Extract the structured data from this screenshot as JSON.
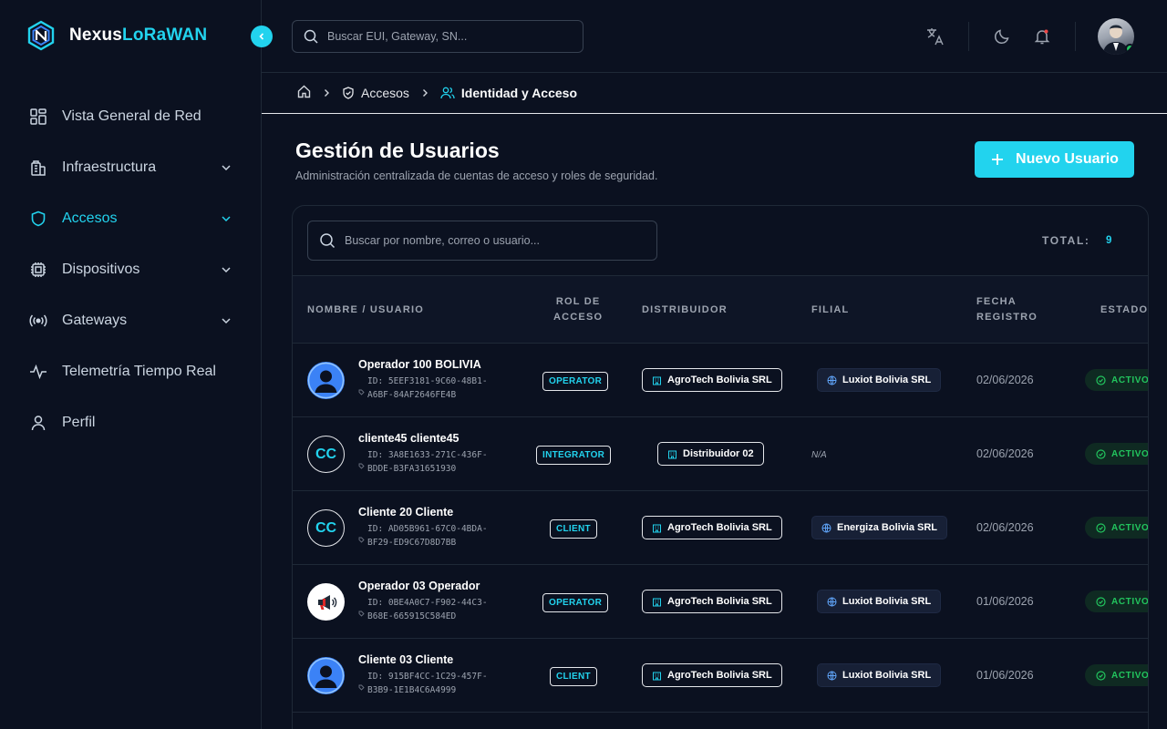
{
  "brand": {
    "name_part1": "Nexus",
    "name_part2": "LoRaWAN"
  },
  "sidebar": {
    "items": [
      {
        "label": "Vista General de Red",
        "icon": "grid-icon",
        "active": false,
        "has_chevron": false
      },
      {
        "label": "Infraestructura",
        "icon": "building-icon",
        "active": false,
        "has_chevron": true
      },
      {
        "label": "Accesos",
        "icon": "shield-icon",
        "active": true,
        "has_chevron": true
      },
      {
        "label": "Dispositivos",
        "icon": "chip-icon",
        "active": false,
        "has_chevron": true
      },
      {
        "label": "Gateways",
        "icon": "radio-icon",
        "active": false,
        "has_chevron": true
      },
      {
        "label": "Telemetría Tiempo Real",
        "icon": "activity-icon",
        "active": false,
        "has_chevron": false
      },
      {
        "label": "Perfil",
        "icon": "user-icon",
        "active": false,
        "has_chevron": false
      }
    ]
  },
  "topbar": {
    "search_placeholder": "Buscar EUI, Gateway, SN..."
  },
  "breadcrumb": {
    "items": [
      "Accesos",
      "Identidad y Acceso"
    ]
  },
  "page": {
    "title": "Gestión de Usuarios",
    "subtitle": "Administración centralizada de cuentas de acceso y roles de seguridad.",
    "new_button": "Nuevo Usuario"
  },
  "table": {
    "search_placeholder": "Buscar por nombre, correo o usuario...",
    "total_label": "TOTAL:",
    "total_value": "9",
    "headers": {
      "name": "NOMBRE / USUARIO",
      "role_line1": "ROL DE",
      "role_line2": "ACCESO",
      "distributor": "DISTRIBUIDOR",
      "branch": "FILIAL",
      "date_line1": "FECHA",
      "date_line2": "REGISTRO",
      "status": "ESTADO"
    },
    "rows": [
      {
        "name": "Operador 100 BOLIVIA",
        "id_line1": "ID: 5EEF3181-9C60-48B1-",
        "id_line2": "A6BF-84AF2646FE4B",
        "avatar": "user-silhouette",
        "initials": "",
        "role": "OPERATOR",
        "distributor": "AgroTech Bolivia SRL",
        "branch": "Luxiot Bolivia SRL",
        "date": "02/06/2026",
        "status": "ACTIVO"
      },
      {
        "name": "cliente45 cliente45",
        "id_line1": "ID: 3A8E1633-271C-436F-",
        "id_line2": "BDDE-B3FA31651930",
        "avatar": "initials",
        "initials": "CC",
        "role": "INTEGRATOR",
        "distributor": "Distribuidor 02",
        "branch": "N/A",
        "date": "02/06/2026",
        "status": "ACTIVO"
      },
      {
        "name": "Cliente 20 Cliente",
        "id_line1": "ID: AD05B961-67C0-4BDA-",
        "id_line2": "BF29-ED9C67D8D7BB",
        "avatar": "initials",
        "initials": "CC",
        "role": "CLIENT",
        "distributor": "AgroTech Bolivia SRL",
        "branch": "Energiza Bolivia SRL",
        "date": "02/06/2026",
        "status": "ACTIVO"
      },
      {
        "name": "Operador 03 Operador",
        "id_line1": "ID: 0BE4A0C7-F902-44C3-",
        "id_line2": "B68E-665915C584ED",
        "avatar": "megaphone",
        "initials": "",
        "role": "OPERATOR",
        "distributor": "AgroTech Bolivia SRL",
        "branch": "Luxiot Bolivia SRL",
        "date": "01/06/2026",
        "status": "ACTIVO"
      },
      {
        "name": "Cliente 03 Cliente",
        "id_line1": "ID: 915BF4CC-1C29-457F-",
        "id_line2": "B3B9-1E1B4C6A4999",
        "avatar": "user-silhouette",
        "initials": "",
        "role": "CLIENT",
        "distributor": "AgroTech Bolivia SRL",
        "branch": "Luxiot Bolivia SRL",
        "date": "01/06/2026",
        "status": "ACTIVO"
      }
    ]
  },
  "colors": {
    "accent": "#22d3ee",
    "background": "#0b1120",
    "success": "#22c55e",
    "border": "#1f2937"
  }
}
